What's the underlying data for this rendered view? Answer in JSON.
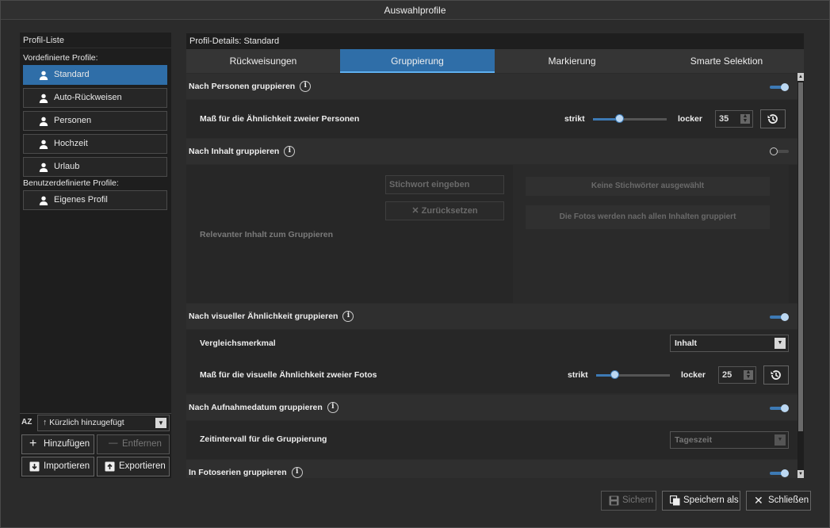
{
  "window": {
    "title": "Auswahlprofile"
  },
  "left": {
    "header": "Profil-Liste",
    "predefined_label": "Vordefinierte Profile:",
    "predefined": [
      "Standard",
      "Auto-Rückweisen",
      "Personen",
      "Hochzeit",
      "Urlaub"
    ],
    "custom_label": "Benutzerdefinierte Profile:",
    "custom": [
      "Eigenes Profil"
    ],
    "sort_icon": "AZ",
    "sort": "Kürzlich hinzugefügt",
    "buttons": {
      "add": "Hinzufügen",
      "remove": "Entfernen",
      "import": "Importieren",
      "export": "Exportieren"
    }
  },
  "right": {
    "header": "Profil-Details: Standard",
    "tabs": [
      "Rückweisungen",
      "Gruppierung",
      "Markierung",
      "Smarte Selektion"
    ],
    "active_tab": 1,
    "sections": {
      "persons": {
        "title": "Nach Personen gruppieren",
        "enabled": true,
        "similarity_label": "Maß für die Ähnlichkeit zweier Personen",
        "strict": "strikt",
        "loose": "locker",
        "value": "35",
        "slider_fraction": 0.35
      },
      "content": {
        "title": "Nach Inhalt gruppieren",
        "enabled": false,
        "relevant_label": "Relevanter Inhalt zum Gruppieren",
        "keyword_placeholder": "Stichwort eingeben",
        "reset": "Zurücksetzen",
        "no_keywords": "Keine Stichwörter ausgewählt",
        "info": "Die Fotos werden nach allen Inhalten gruppiert"
      },
      "visual": {
        "title": "Nach visueller Ähnlichkeit gruppieren",
        "enabled": true,
        "feature_label": "Vergleichsmerkmal",
        "feature_value": "Inhalt",
        "similarity_label": "Maß für die visuelle Ähnlichkeit zweier Fotos",
        "strict": "strikt",
        "loose": "locker",
        "value": "25",
        "slider_fraction": 0.25
      },
      "date": {
        "title": "Nach Aufnahmedatum gruppieren",
        "enabled": true,
        "interval_label": "Zeitintervall für die Gruppierung",
        "interval_value": "Tageszeit"
      },
      "series": {
        "title": "In Fotoserien gruppieren",
        "enabled": true
      }
    }
  },
  "footer": {
    "save": "Sichern",
    "save_as": "Speichern als",
    "close": "Schließen"
  }
}
